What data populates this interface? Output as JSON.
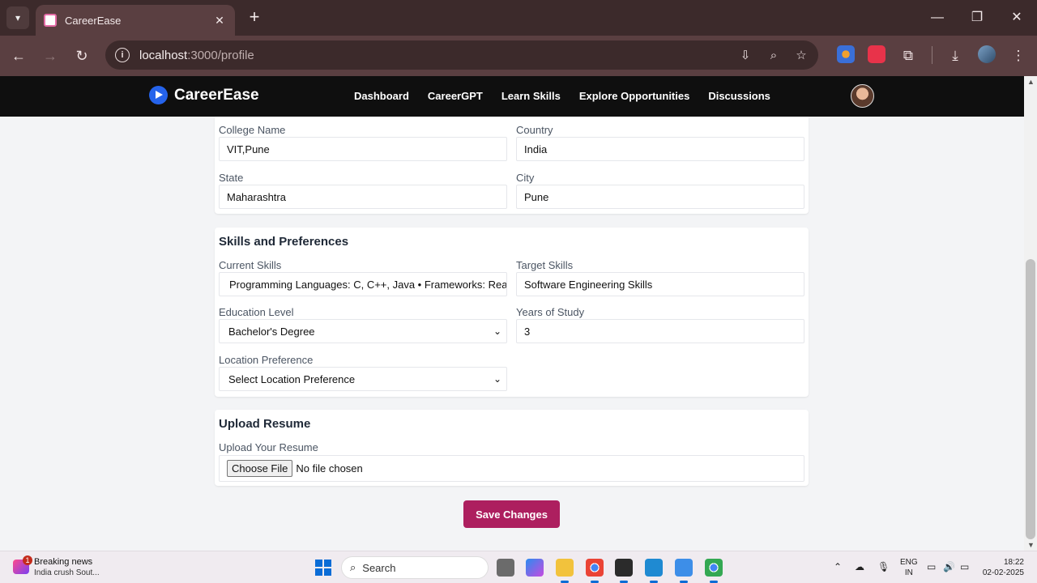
{
  "browser": {
    "tab_title": "CareerEase",
    "tab_close": "✕",
    "new_tab": "+",
    "url_host": "localhost",
    "url_path": ":3000/profile"
  },
  "app": {
    "brand": "CareerEase",
    "nav": [
      "Dashboard",
      "CareerGPT",
      "Learn Skills",
      "Explore Opportunities",
      "Discussions"
    ]
  },
  "location_card": {
    "college_label": "College Name",
    "college_value": "VIT,Pune",
    "country_label": "Country",
    "country_value": "India",
    "state_label": "State",
    "state_value": "Maharashtra",
    "city_label": "City",
    "city_value": "Pune"
  },
  "skills_card": {
    "title": "Skills and Preferences",
    "current_skills_label": "Current Skills",
    "current_skills_value": "Programming Languages: C, C++, Java  • Frameworks: Rea",
    "target_skills_label": "Target Skills",
    "target_skills_value": "Software Engineering Skills",
    "education_label": "Education Level",
    "education_value": "Bachelor's Degree",
    "years_label": "Years of Study",
    "years_value": "3",
    "location_pref_label": "Location Preference",
    "location_pref_value": "Select Location Preference"
  },
  "resume_card": {
    "title": "Upload Resume",
    "upload_label": "Upload Your Resume",
    "choose_file": "Choose File",
    "file_status": "No file chosen"
  },
  "save_button": "Save Changes",
  "taskbar": {
    "news_badge": "1",
    "news_title": "Breaking news",
    "news_sub": "India crush Sout...",
    "search": "Search",
    "lang_line1": "ENG",
    "lang_line2": "IN",
    "time": "18:22",
    "date": "02-02-2025"
  },
  "colors": {
    "accent": "#ad1f5f",
    "nav_bg": "#0f0f0f",
    "brand_logo": "#2563eb",
    "chrome_bg": "#5a3f41"
  }
}
